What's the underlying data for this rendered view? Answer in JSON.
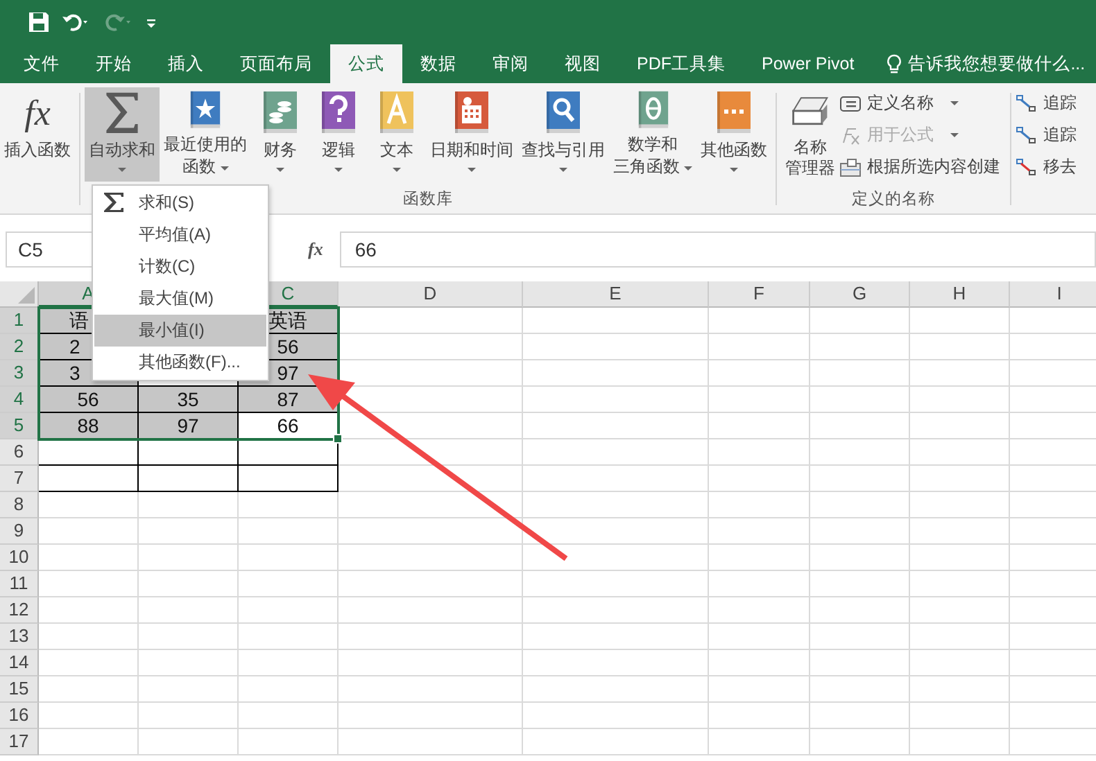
{
  "quick_access": {
    "redo_disabled": true
  },
  "tabs": [
    {
      "label": "文件",
      "selected": false
    },
    {
      "label": "开始",
      "selected": false
    },
    {
      "label": "插入",
      "selected": false
    },
    {
      "label": "页面布局",
      "selected": false
    },
    {
      "label": "公式",
      "selected": true
    },
    {
      "label": "数据",
      "selected": false
    },
    {
      "label": "审阅",
      "selected": false
    },
    {
      "label": "视图",
      "selected": false
    },
    {
      "label": "PDF工具集",
      "selected": false
    },
    {
      "label": "Power Pivot",
      "selected": false
    }
  ],
  "tell_me": "告诉我您想要做什么...",
  "ribbon": {
    "insert_function": {
      "symbol": "fx",
      "label": "插入函数"
    },
    "function_library": {
      "label": "函数库",
      "buttons": [
        {
          "lines": [
            "自动求和"
          ],
          "kind": "sigma",
          "pressed": true
        },
        {
          "lines": [
            "最近使用的",
            "函数"
          ],
          "kind": "book",
          "color": "#3f7cc0",
          "pressed": false
        },
        {
          "lines": [
            "财务"
          ],
          "kind": "book",
          "color": "#6fa38e",
          "pressed": false
        },
        {
          "lines": [
            "逻辑"
          ],
          "kind": "book",
          "color": "#8e59b6",
          "pressed": false
        },
        {
          "lines": [
            "文本"
          ],
          "kind": "book",
          "color": "#efc25c",
          "pressed": false
        },
        {
          "lines": [
            "日期和时间"
          ],
          "kind": "book",
          "color": "#d65a3c",
          "pressed": false
        },
        {
          "lines": [
            "查找与引用"
          ],
          "kind": "book",
          "color": "#3f7cc0",
          "pressed": false
        },
        {
          "lines": [
            "数学和",
            "三角函数"
          ],
          "kind": "book",
          "color": "#6fa38e",
          "pressed": false
        },
        {
          "lines": [
            "其他函数"
          ],
          "kind": "book",
          "color": "#e88a3c",
          "pressed": false
        }
      ]
    },
    "defined_names": {
      "label": "定义的名称",
      "manager": [
        "名称",
        "管理器"
      ],
      "items": [
        {
          "label": "定义名称",
          "dropdown": true,
          "disabled": false
        },
        {
          "label": "用于公式",
          "dropdown": true,
          "disabled": true
        },
        {
          "label": "根据所选内容创建",
          "dropdown": false,
          "disabled": false
        }
      ]
    },
    "formula_auditing": {
      "items": [
        {
          "label": "追踪"
        },
        {
          "label": "追踪"
        },
        {
          "label": "移去"
        }
      ]
    }
  },
  "formula_bar": {
    "name_box": "C5",
    "fx": "fx",
    "value": "66"
  },
  "sheet": {
    "columns": [
      {
        "label": "A",
        "selected": true
      },
      {},
      {
        "label": "C",
        "selected": true
      },
      {
        "label": "D",
        "selected": false
      },
      {
        "label": "E",
        "selected": false
      },
      {
        "label": "F",
        "selected": false
      },
      {
        "label": "G",
        "selected": false
      },
      {
        "label": "H",
        "selected": false
      },
      {
        "label": "I",
        "selected": false
      }
    ],
    "rows": [
      {
        "num": "1",
        "selected": true,
        "bordered": true,
        "cells": [
          {
            "text": "语",
            "selected": true,
            "cut": true
          },
          {},
          {
            "text": "英语",
            "selected": true
          }
        ]
      },
      {
        "num": "2",
        "selected": true,
        "bordered": true,
        "cells": [
          {
            "text": "2",
            "selected": true,
            "cut": true
          },
          {},
          {
            "text": "56",
            "selected": true
          }
        ]
      },
      {
        "num": "3",
        "selected": true,
        "bordered": true,
        "cells": [
          {
            "text": "3",
            "selected": true,
            "cut": true
          },
          {},
          {
            "text": "97",
            "selected": true
          }
        ]
      },
      {
        "num": "4",
        "selected": true,
        "bordered": true,
        "cells": [
          {
            "text": "56",
            "selected": true
          },
          {
            "text": "35",
            "selected": true
          },
          {
            "text": "87",
            "selected": true
          }
        ]
      },
      {
        "num": "5",
        "selected": true,
        "bordered": true,
        "cells": [
          {
            "text": "88",
            "selected": true
          },
          {
            "text": "97",
            "selected": true
          },
          {
            "text": "66",
            "selected": false
          }
        ]
      },
      {
        "num": "6",
        "selected": false,
        "bordered": true
      },
      {
        "num": "7",
        "selected": false,
        "bordered": true
      },
      {
        "num": "8",
        "selected": false,
        "bordered": false
      },
      {
        "num": "9",
        "selected": false,
        "bordered": false
      },
      {
        "num": "10",
        "selected": false,
        "bordered": false
      },
      {
        "num": "11",
        "selected": false,
        "bordered": false
      },
      {
        "num": "12",
        "selected": false,
        "bordered": false
      },
      {
        "num": "13",
        "selected": false,
        "bordered": false
      },
      {
        "num": "14",
        "selected": false,
        "bordered": false
      },
      {
        "num": "15",
        "selected": false,
        "bordered": false
      },
      {
        "num": "16",
        "selected": false,
        "bordered": false
      },
      {
        "num": "17",
        "selected": false,
        "bordered": false
      }
    ]
  },
  "autosum_menu": {
    "items": [
      {
        "label": "求和(S)",
        "kind": "sigma",
        "selected": false
      },
      {
        "label": "平均值(A)",
        "kind": "plain",
        "selected": false
      },
      {
        "label": "计数(C)",
        "kind": "plain",
        "selected": false
      },
      {
        "label": "最大值(M)",
        "kind": "plain",
        "selected": false
      },
      {
        "label": "最小值(I)",
        "kind": "plain",
        "selected": true
      },
      {
        "label": "其他函数(F)...",
        "kind": "plain",
        "selected": false
      }
    ]
  }
}
